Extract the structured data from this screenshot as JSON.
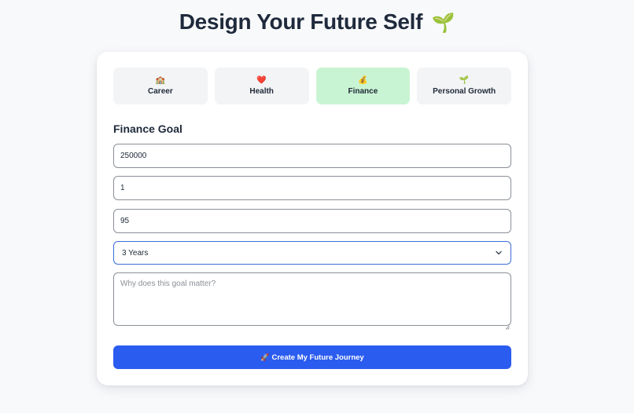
{
  "header": {
    "title": "Design Your Future Self",
    "title_icon": "🌱"
  },
  "tabs": [
    {
      "label": "Career",
      "icon": "🏫",
      "icon_name": "school-icon",
      "active": false
    },
    {
      "label": "Health",
      "icon": "❤️",
      "icon_name": "heart-icon",
      "active": false
    },
    {
      "label": "Finance",
      "icon": "💰",
      "icon_name": "money-bag-icon",
      "active": true
    },
    {
      "label": "Personal Growth",
      "icon": "🌱",
      "icon_name": "seedling-icon",
      "active": false
    }
  ],
  "form": {
    "section_title": "Finance Goal",
    "field_1_value": "250000",
    "field_2_value": "1",
    "field_3_value": "95",
    "timeframe": {
      "selected": "3 Years"
    },
    "why": {
      "value": "",
      "placeholder": "Why does this goal matter?"
    },
    "submit": {
      "icon": "🚀",
      "label": "Create My Future Journey"
    }
  },
  "colors": {
    "active_tab": "#c9f4d3",
    "tab_bg": "#f3f4f6",
    "primary": "#2b5cf0",
    "focus_border": "#3b6fd8",
    "page_bg": "#f8f9fb"
  }
}
